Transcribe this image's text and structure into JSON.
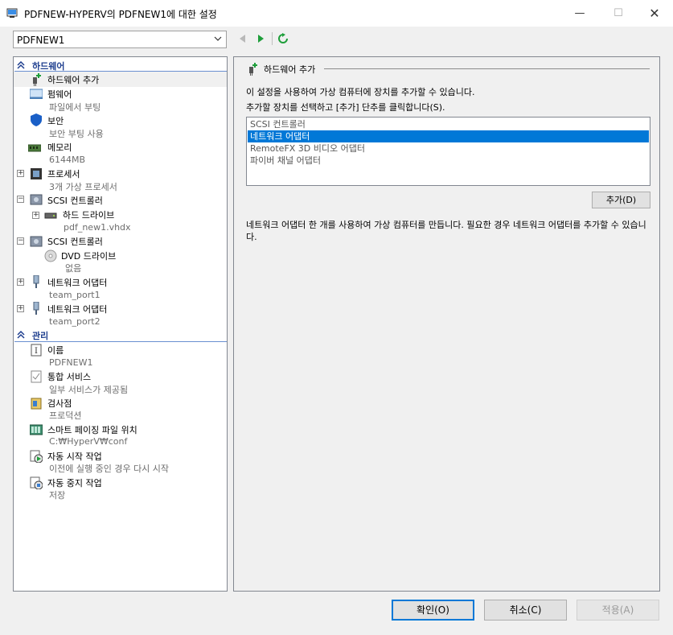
{
  "window": {
    "title": "PDFNEW-HYPERV의 PDFNEW1에 대한 설정",
    "minimize": "—",
    "maximize": "☐",
    "close": "✕"
  },
  "vm_selector": {
    "value": "PDFNEW1"
  },
  "hardware_section": {
    "label": "하드웨어",
    "items": [
      {
        "label": "하드웨어 추가",
        "icon": "add-hardware-icon"
      },
      {
        "label": "펌웨어",
        "sub": "파일에서 부팅",
        "icon": "firmware-icon"
      },
      {
        "label": "보안",
        "sub": "보안 부팅 사용",
        "icon": "shield-icon"
      },
      {
        "label": "메모리",
        "sub": "6144MB",
        "icon": "memory-icon"
      },
      {
        "label": "프로세서",
        "sub": "3개 가상 프로세서",
        "icon": "processor-icon"
      },
      {
        "label": "SCSI 컨트롤러",
        "icon": "scsi-controller-icon"
      },
      {
        "label": "하드 드라이브",
        "sub": "pdf_new1.vhdx",
        "icon": "hard-drive-icon"
      },
      {
        "label": "SCSI 컨트롤러",
        "icon": "scsi-controller-icon"
      },
      {
        "label": "DVD 드라이브",
        "sub": "없음",
        "icon": "dvd-icon"
      },
      {
        "label": "네트워크 어댑터",
        "sub": "team_port1",
        "icon": "network-adapter-icon"
      },
      {
        "label": "네트워크 어댑터",
        "sub": "team_port2",
        "icon": "network-adapter-icon"
      }
    ]
  },
  "management_section": {
    "label": "관리",
    "items": [
      {
        "label": "이름",
        "sub": "PDFNEW1",
        "icon": "name-icon"
      },
      {
        "label": "통합 서비스",
        "sub": "일부 서비스가 제공됨",
        "icon": "integration-services-icon"
      },
      {
        "label": "검사점",
        "sub": "프로덕션",
        "icon": "checkpoint-icon"
      },
      {
        "label": "스마트 페이징 파일 위치",
        "sub": "C:₩HyperV₩conf",
        "icon": "smart-paging-icon"
      },
      {
        "label": "자동 시작 작업",
        "sub": "이전에 실행 중인 경우 다시 시작",
        "icon": "auto-start-icon"
      },
      {
        "label": "자동 중지 작업",
        "sub": "저장",
        "icon": "auto-stop-icon"
      }
    ]
  },
  "content": {
    "group_title": "하드웨어 추가",
    "description1": "이 설정을 사용하여 가상 컴퓨터에 장치를 추가할 수 있습니다.",
    "description2": "추가할 장치를 선택하고 [추가] 단추를 클릭합니다(S).",
    "devices": [
      "SCSI 컨트롤러",
      "네트워크 어댑터",
      "RemoteFX 3D 비디오 어댑터",
      "파이버 채널 어댑터"
    ],
    "selected_device": "네트워크 어댑터",
    "add_button": "추가(D)",
    "description3": "네트워크 어댑터 한 개를 사용하여 가상 컴퓨터를 만듭니다. 필요한 경우 네트워크 어댑터를 추가할 수 있습니다."
  },
  "buttons": {
    "ok": "확인(O)",
    "cancel": "취소(C)",
    "apply": "적용(A)"
  },
  "colors": {
    "accent": "#0078d7",
    "section_header": "#1f3f8f",
    "secondary_text": "#6d6d6d"
  }
}
